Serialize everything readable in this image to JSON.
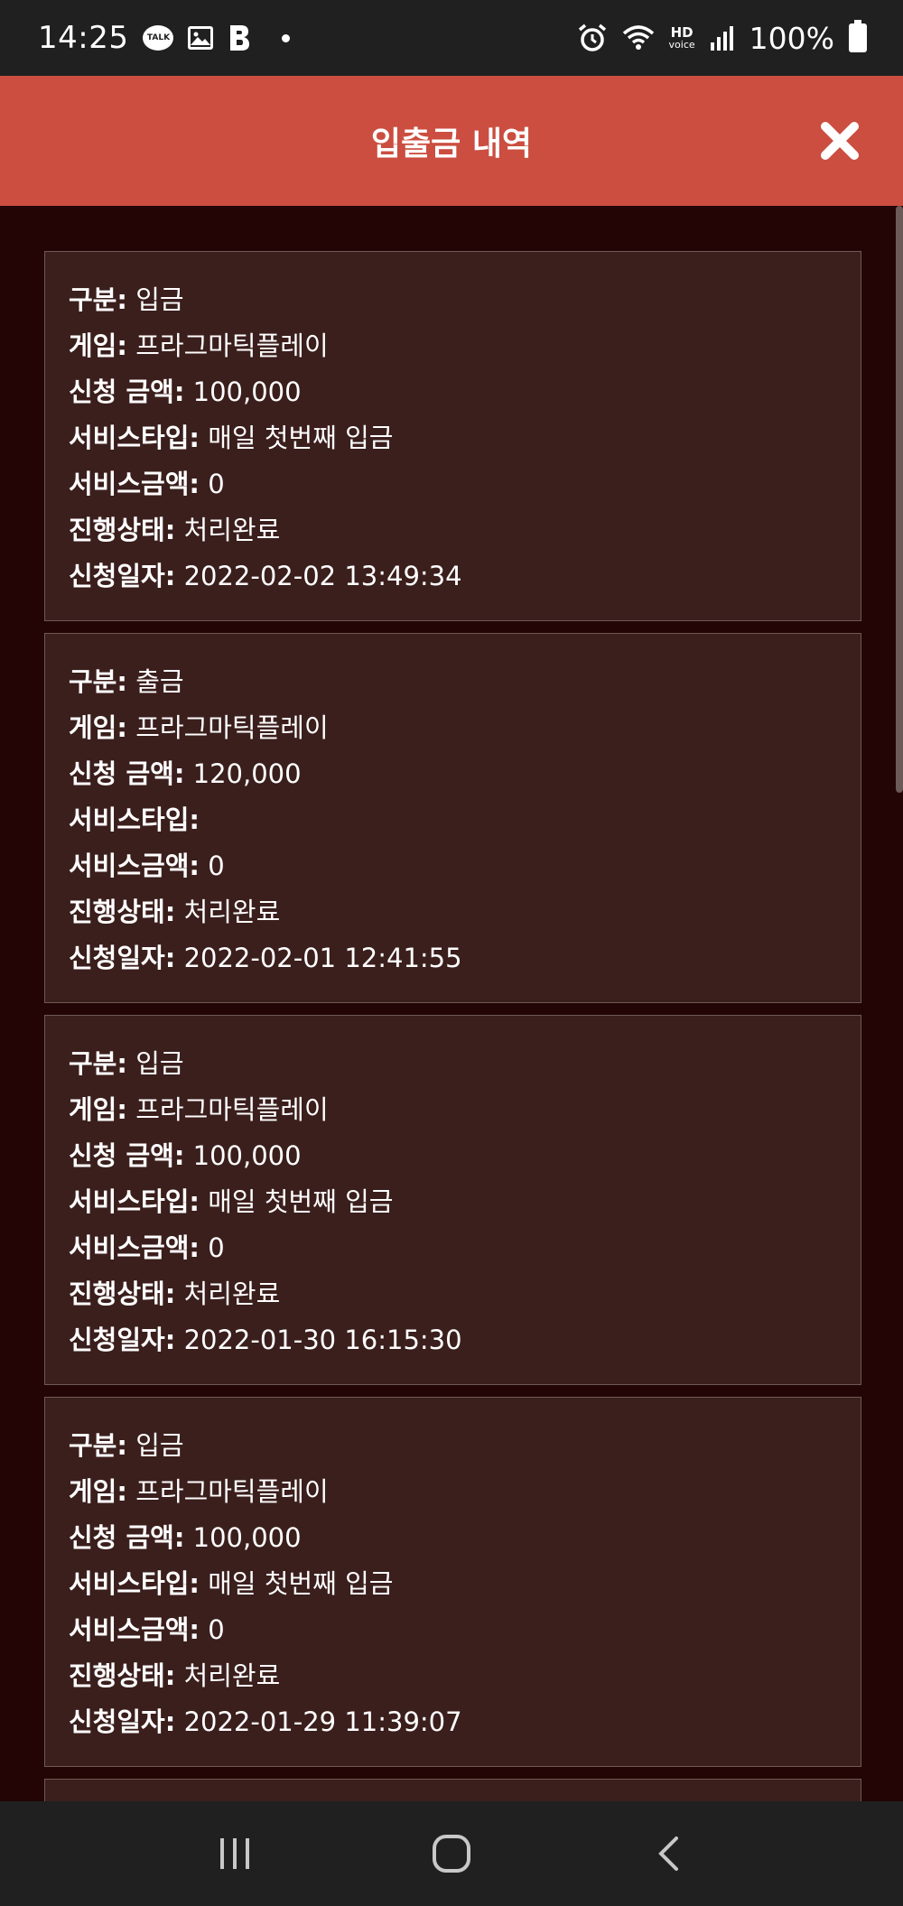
{
  "status_bar": {
    "time": "14:25",
    "talk_label": "TALK",
    "hd_label": "HD",
    "voice_label": "voice",
    "battery": "100%"
  },
  "header": {
    "title": "입출금 내역"
  },
  "records": [
    {
      "type_label": "구분",
      "type": "입금",
      "game_label": "게임",
      "game": "프라그마틱플레이",
      "amount_label": "신청 금액",
      "amount": "100,000",
      "service_type_label": "서비스타입",
      "service_type": "매일 첫번째 입금",
      "service_amount_label": "서비스금액",
      "service_amount": "0",
      "status_label": "진행상태",
      "status": "처리완료",
      "date_label": "신청일자",
      "date": "2022-02-02 13:49:34"
    },
    {
      "type_label": "구분",
      "type": "출금",
      "game_label": "게임",
      "game": "프라그마틱플레이",
      "amount_label": "신청 금액",
      "amount": "120,000",
      "service_type_label": "서비스타입",
      "service_type": "",
      "service_amount_label": "서비스금액",
      "service_amount": "0",
      "status_label": "진행상태",
      "status": "처리완료",
      "date_label": "신청일자",
      "date": "2022-02-01 12:41:55"
    },
    {
      "type_label": "구분",
      "type": "입금",
      "game_label": "게임",
      "game": "프라그마틱플레이",
      "amount_label": "신청 금액",
      "amount": "100,000",
      "service_type_label": "서비스타입",
      "service_type": "매일 첫번째 입금",
      "service_amount_label": "서비스금액",
      "service_amount": "0",
      "status_label": "진행상태",
      "status": "처리완료",
      "date_label": "신청일자",
      "date": "2022-01-30 16:15:30"
    },
    {
      "type_label": "구분",
      "type": "입금",
      "game_label": "게임",
      "game": "프라그마틱플레이",
      "amount_label": "신청 금액",
      "amount": "100,000",
      "service_type_label": "서비스타입",
      "service_type": "매일 첫번째 입금",
      "service_amount_label": "서비스금액",
      "service_amount": "0",
      "status_label": "진행상태",
      "status": "처리완료",
      "date_label": "신청일자",
      "date": "2022-01-29 11:39:07"
    }
  ],
  "colors": {
    "header": "#cb4e40",
    "background": "#220504",
    "card": "#3b1f1d",
    "card_border": "#6f5855"
  },
  "icons": {
    "close": "close-icon",
    "nav_recents": "recents-icon",
    "nav_home": "home-icon",
    "nav_back": "back-icon"
  }
}
